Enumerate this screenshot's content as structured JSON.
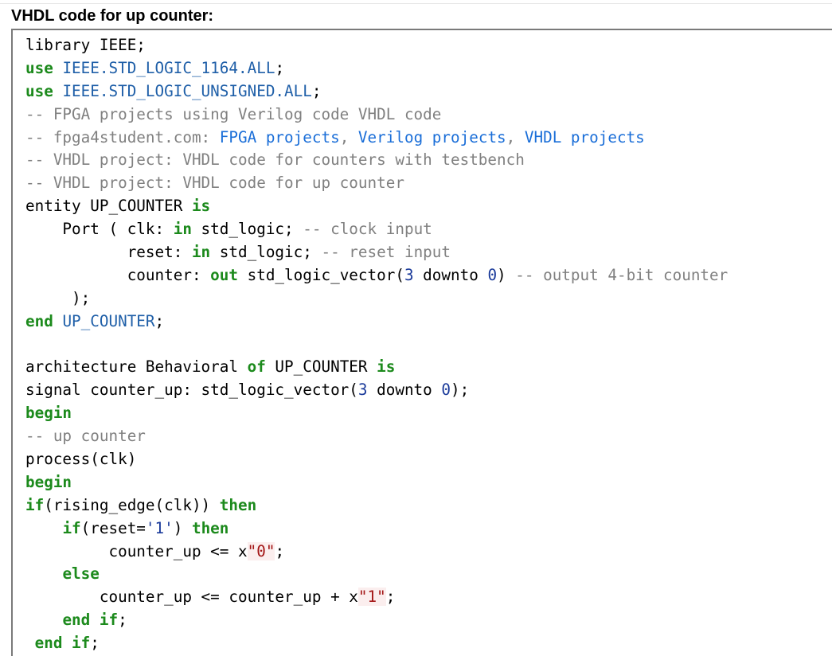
{
  "heading": "VHDL code for up counter:",
  "code_lines": [
    [
      {
        "t": "library IEEE;",
        "c": "pl"
      }
    ],
    [
      {
        "t": "use ",
        "c": "kw"
      },
      {
        "t": "IEEE.STD_LOGIC_1164.ALL",
        "c": "id"
      },
      {
        "t": ";",
        "c": "pl"
      }
    ],
    [
      {
        "t": "use ",
        "c": "kw"
      },
      {
        "t": "IEEE.STD_LOGIC_UNSIGNED.ALL",
        "c": "id"
      },
      {
        "t": ";",
        "c": "pl"
      }
    ],
    [
      {
        "t": "-- FPGA projects using Verilog code VHDL code",
        "c": "cm"
      }
    ],
    [
      {
        "t": "-- fpga4student.com: ",
        "c": "cm"
      },
      {
        "t": "FPGA projects",
        "c": "lk"
      },
      {
        "t": ", ",
        "c": "cm"
      },
      {
        "t": "Verilog projects",
        "c": "lk"
      },
      {
        "t": ", ",
        "c": "cm"
      },
      {
        "t": "VHDL projects",
        "c": "lk"
      }
    ],
    [
      {
        "t": "-- VHDL project: VHDL code for counters with testbench",
        "c": "cm"
      }
    ],
    [
      {
        "t": "-- VHDL project: VHDL code for up counter",
        "c": "cm"
      }
    ],
    [
      {
        "t": "entity UP_COUNTER ",
        "c": "pl"
      },
      {
        "t": "is",
        "c": "kw"
      }
    ],
    [
      {
        "t": "    Port ( clk: ",
        "c": "pl"
      },
      {
        "t": "in",
        "c": "kw"
      },
      {
        "t": " std_logic; ",
        "c": "pl"
      },
      {
        "t": "-- clock input",
        "c": "cm"
      }
    ],
    [
      {
        "t": "           reset: ",
        "c": "pl"
      },
      {
        "t": "in",
        "c": "kw"
      },
      {
        "t": " std_logic; ",
        "c": "pl"
      },
      {
        "t": "-- reset input",
        "c": "cm"
      }
    ],
    [
      {
        "t": "           counter: ",
        "c": "pl"
      },
      {
        "t": "out",
        "c": "kw"
      },
      {
        "t": " std_logic_vector(",
        "c": "pl"
      },
      {
        "t": "3",
        "c": "num"
      },
      {
        "t": " downto ",
        "c": "pl"
      },
      {
        "t": "0",
        "c": "num"
      },
      {
        "t": ") ",
        "c": "pl"
      },
      {
        "t": "-- output 4-bit counter",
        "c": "cm"
      }
    ],
    [
      {
        "t": "     );",
        "c": "pl"
      }
    ],
    [
      {
        "t": "end ",
        "c": "kw"
      },
      {
        "t": "UP_COUNTER",
        "c": "id"
      },
      {
        "t": ";",
        "c": "pl"
      }
    ],
    [
      {
        "t": "",
        "c": "pl"
      }
    ],
    [
      {
        "t": "architecture Behavioral ",
        "c": "pl"
      },
      {
        "t": "of",
        "c": "kw"
      },
      {
        "t": " UP_COUNTER ",
        "c": "pl"
      },
      {
        "t": "is",
        "c": "kw"
      }
    ],
    [
      {
        "t": "signal counter_up: std_logic_vector(",
        "c": "pl"
      },
      {
        "t": "3",
        "c": "num"
      },
      {
        "t": " downto ",
        "c": "pl"
      },
      {
        "t": "0",
        "c": "num"
      },
      {
        "t": ");",
        "c": "pl"
      }
    ],
    [
      {
        "t": "begin",
        "c": "kw"
      }
    ],
    [
      {
        "t": "-- up counter",
        "c": "cm"
      }
    ],
    [
      {
        "t": "process(clk)",
        "c": "pl"
      }
    ],
    [
      {
        "t": "begin",
        "c": "kw"
      }
    ],
    [
      {
        "t": "if",
        "c": "kw"
      },
      {
        "t": "(rising_edge(clk)) ",
        "c": "pl"
      },
      {
        "t": "then",
        "c": "kw"
      }
    ],
    [
      {
        "t": "    ",
        "c": "pl"
      },
      {
        "t": "if",
        "c": "kw"
      },
      {
        "t": "(reset=",
        "c": "pl"
      },
      {
        "t": "'1'",
        "c": "num"
      },
      {
        "t": ") ",
        "c": "pl"
      },
      {
        "t": "then",
        "c": "kw"
      }
    ],
    [
      {
        "t": "         counter_up <= x",
        "c": "pl"
      },
      {
        "t": "\"0\"",
        "c": "str"
      },
      {
        "t": ";",
        "c": "pl"
      }
    ],
    [
      {
        "t": "    ",
        "c": "pl"
      },
      {
        "t": "else",
        "c": "kw"
      }
    ],
    [
      {
        "t": "        counter_up <= counter_up + x",
        "c": "pl"
      },
      {
        "t": "\"1\"",
        "c": "str"
      },
      {
        "t": ";",
        "c": "pl"
      }
    ],
    [
      {
        "t": "    ",
        "c": "pl"
      },
      {
        "t": "end if",
        "c": "kw"
      },
      {
        "t": ";",
        "c": "pl"
      }
    ],
    [
      {
        "t": " ",
        "c": "pl"
      },
      {
        "t": "end if",
        "c": "kw"
      },
      {
        "t": ";",
        "c": "pl"
      }
    ]
  ]
}
